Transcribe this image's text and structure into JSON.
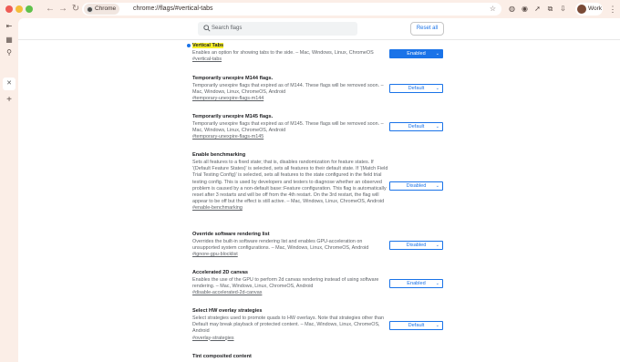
{
  "browser": {
    "chip_label": "Chrome",
    "url": "chrome://flags/#vertical-tabs",
    "profile_label": "Work"
  },
  "page": {
    "search_placeholder": "Search flags",
    "reset_label": "Reset all"
  },
  "flags": [
    {
      "title": "Vertical Tabs",
      "description": "Enables an option for showing tabs to the side. – Mac, Windows, Linux, ChromeOS",
      "link": "#vertical-tabs",
      "state": "Enabled"
    },
    {
      "title": "Temporarily unexpire M144 flags.",
      "description": "Temporarily unexpire flags that expired as of M144. These flags will be removed soon. – Mac, Windows, Linux, ChromeOS, Android",
      "link": "#temporary-unexpire-flags-m144",
      "state": "Default"
    },
    {
      "title": "Temporarily unexpire M145 flags.",
      "description": "Temporarily unexpire flags that expired as of M145. These flags will be removed soon. – Mac, Windows, Linux, ChromeOS, Android",
      "link": "#temporary-unexpire-flags-m145",
      "state": "Default"
    },
    {
      "title": "Enable benchmarking",
      "description": "Sets all features to a fixed state; that is, disables randomization for feature states. If '(Default Feature States)' is selected, sets all features to their default state. If '(Match Field Trial Testing Config)' is selected, sets all features to the state configured in the field trial testing config. This is used by developers and testers to diagnose whether an observed problem is caused by a non-default base::Feature configuration. This flag is automatically reset after 3 restarts and will be off from the 4th restart. On the 3rd restart, the flag will appear to be off but the effect is still active. – Mac, Windows, Linux, ChromeOS, Android",
      "link": "#enable-benchmarking",
      "state": "Disabled"
    },
    {
      "title": "Override software rendering list",
      "description": "Overrides the built-in software rendering list and enables GPU-acceleration on unsupported system configurations. – Mac, Windows, Linux, ChromeOS, Android",
      "link": "#ignore-gpu-blocklist",
      "state": "Disabled"
    },
    {
      "title": "Accelerated 2D canvas",
      "description": "Enables the use of the GPU to perform 2d canvas rendering instead of using software rendering. – Mac, Windows, Linux, ChromeOS, Android",
      "link": "#disable-accelerated-2d-canvas",
      "state": "Enabled"
    },
    {
      "title": "Select HW overlay strategies",
      "description": "Select strategies used to promote quads to HW overlays. Note that strategies other than Default may break playback of protected content. – Mac, Windows, Linux, ChromeOS, Android",
      "link": "#overlay-strategies",
      "state": "Default"
    },
    {
      "title": "Tint composited content",
      "description": "",
      "link": "",
      "state": ""
    }
  ]
}
